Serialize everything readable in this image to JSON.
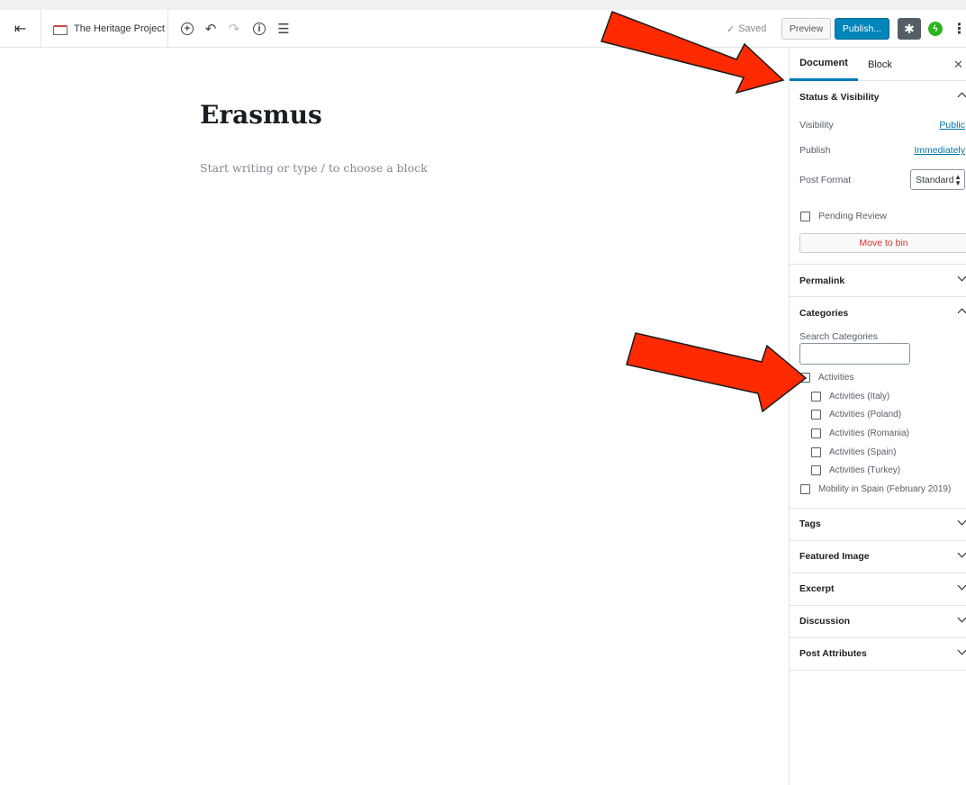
{
  "header": {
    "site_title": "The Heritage Project",
    "saved_label": "Saved",
    "preview_label": "Preview",
    "publish_label": "Publish..."
  },
  "editor": {
    "title": "Erasmus",
    "block_placeholder": "Start writing or type / to choose a block"
  },
  "sidebar": {
    "tabs": [
      "Document",
      "Block"
    ],
    "status": {
      "heading": "Status & Visibility",
      "visibility_label": "Visibility",
      "visibility_value": "Public",
      "publish_label": "Publish",
      "publish_value": "Immediately",
      "format_label": "Post Format",
      "format_value": "Standard",
      "pending_label": "Pending Review",
      "bin_label": "Move to bin"
    },
    "permalink": "Permalink",
    "categories": {
      "heading": "Categories",
      "search_label": "Search Categories",
      "items": [
        {
          "label": "Activities",
          "level": 0
        },
        {
          "label": "Activities (Italy)",
          "level": 1
        },
        {
          "label": "Activities (Poland)",
          "level": 1
        },
        {
          "label": "Activities (Romania)",
          "level": 1
        },
        {
          "label": "Activities (Spain)",
          "level": 1
        },
        {
          "label": "Activities (Turkey)",
          "level": 1
        },
        {
          "label": "Mobility in Spain (February 2019)",
          "level": 0
        }
      ]
    },
    "collapsed_panels": [
      "Tags",
      "Featured Image",
      "Excerpt",
      "Discussion",
      "Post Attributes"
    ]
  },
  "colors": {
    "primary_blue": "#0085ba",
    "arrow_red": "#ff2a00",
    "bin_red": "#dc3232"
  }
}
